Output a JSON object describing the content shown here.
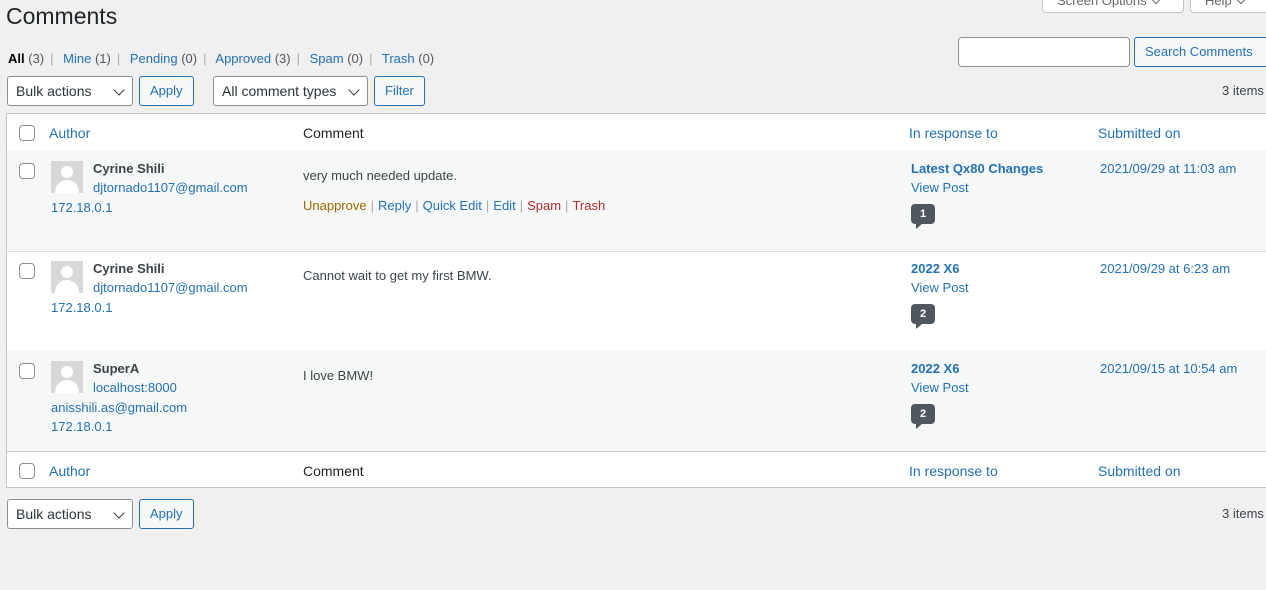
{
  "top_tabs": {
    "screen_options": "Screen Options",
    "help": "Help"
  },
  "page_title": "Comments",
  "filters": [
    {
      "label": "All",
      "count": "(3)",
      "current": true
    },
    {
      "label": "Mine",
      "count": "(1)"
    },
    {
      "label": "Pending",
      "count": "(0)"
    },
    {
      "label": "Approved",
      "count": "(3)"
    },
    {
      "label": "Spam",
      "count": "(0)"
    },
    {
      "label": "Trash",
      "count": "(0)"
    }
  ],
  "search": {
    "value": "",
    "button_label": "Search Comments"
  },
  "top_nav": {
    "bulk_actions": "Bulk actions",
    "apply": "Apply",
    "comment_type": "All comment types",
    "filter": "Filter",
    "items": "3 items"
  },
  "columns": {
    "author": "Author",
    "comment": "Comment",
    "in_response_to": "In response to",
    "submitted_on": "Submitted on"
  },
  "rows": [
    {
      "author": "Cyrine Shili",
      "email": "djtornado1107@gmail.com",
      "url": "",
      "ip": "172.18.0.1",
      "comment": "very much needed update.",
      "post_title": "Latest Qx80 Changes",
      "view_post": "View Post",
      "comment_count": "1",
      "date": "2021/09/29 at 11:03 am",
      "actions": {
        "unapprove": "Unapprove",
        "reply": "Reply",
        "quick_edit": "Quick Edit",
        "edit": "Edit",
        "spam": "Spam",
        "trash": "Trash"
      }
    },
    {
      "author": "Cyrine Shili",
      "email": "djtornado1107@gmail.com",
      "url": "",
      "ip": "172.18.0.1",
      "comment": "Cannot wait to get my first BMW.",
      "post_title": "2022 X6",
      "view_post": "View Post",
      "comment_count": "2",
      "date": "2021/09/29 at 6:23 am"
    },
    {
      "author": "SuperA",
      "url": "localhost:8000",
      "email": "anisshili.as@gmail.com",
      "ip": "172.18.0.1",
      "comment": "I love BMW!",
      "post_title": "2022 X6",
      "view_post": "View Post",
      "comment_count": "2",
      "date": "2021/09/15 at 10:54 am"
    }
  ],
  "bottom_nav": {
    "bulk_actions": "Bulk actions",
    "apply": "Apply",
    "items": "3 items"
  }
}
